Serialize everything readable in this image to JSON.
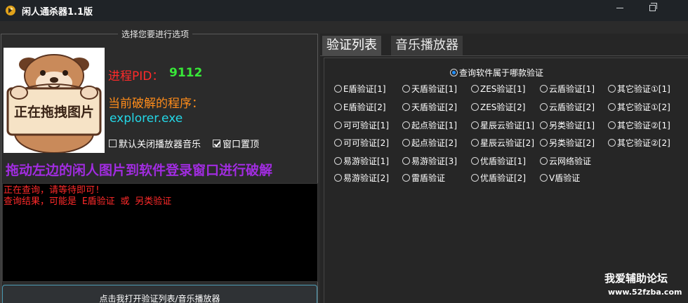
{
  "window": {
    "title": "闲人通杀器1.1版"
  },
  "left": {
    "group_caption": "选择您要进行选项",
    "image_text": "正在拖拽图片",
    "pid_label": "进程PID：",
    "pid_value": "9112",
    "current_label": "当前破解的程序：",
    "current_value": "explorer.exe",
    "checkbox_music": {
      "label": "默认关闭播放器音乐",
      "checked": false
    },
    "checkbox_top": {
      "label": "窗口置顶",
      "checked": true
    },
    "drag_hint": "拖动左边的闲人图片到软件登录窗口进行破解",
    "console_lines": [
      "正在查询，请等待即可!",
      "查询结果，可能是 E盾验证 或 另类验证"
    ],
    "open_button": "点击我打开验证列表/音乐播放器"
  },
  "tabs": [
    "验证列表",
    "音乐播放器"
  ],
  "query_radio": {
    "label": "查询软件属于哪款验证",
    "checked": true
  },
  "radios": [
    [
      "E盾验证[1]",
      "天盾验证[1]",
      "ZES验证[1]",
      "云盾验证[1]",
      "其它验证①[1]"
    ],
    [
      "E盾验证[2]",
      "天盾验证[2]",
      "ZES验证[2]",
      "云盾验证[2]",
      "其它验证①[2]"
    ],
    [
      "可可验证[1]",
      "起点验证[1]",
      "星辰云验证[1]",
      "另类验证[1]",
      "其它验证②[1]"
    ],
    [
      "可可验证[2]",
      "起点验证[2]",
      "星辰云验证[2]",
      "另类验证[2]",
      "其它验证②[2]"
    ],
    [
      "易游验证[1]",
      "易游验证[3]",
      "优盾验证[1]",
      "云网络验证"
    ],
    [
      "易游验证[2]",
      "雷盾验证",
      "优盾验证[2]",
      "V盾验证"
    ]
  ],
  "watermark": {
    "line1": "我爱辅助论坛",
    "line2": "www.52fzba.com"
  },
  "colors": {
    "pid_label": "#ff2a2a",
    "pid_value": "#38e838",
    "current_label": "#ff8c1a",
    "current_value": "#23d8e8",
    "drag_hint": "#a12ce0",
    "console_text": "#ff2a2a"
  }
}
